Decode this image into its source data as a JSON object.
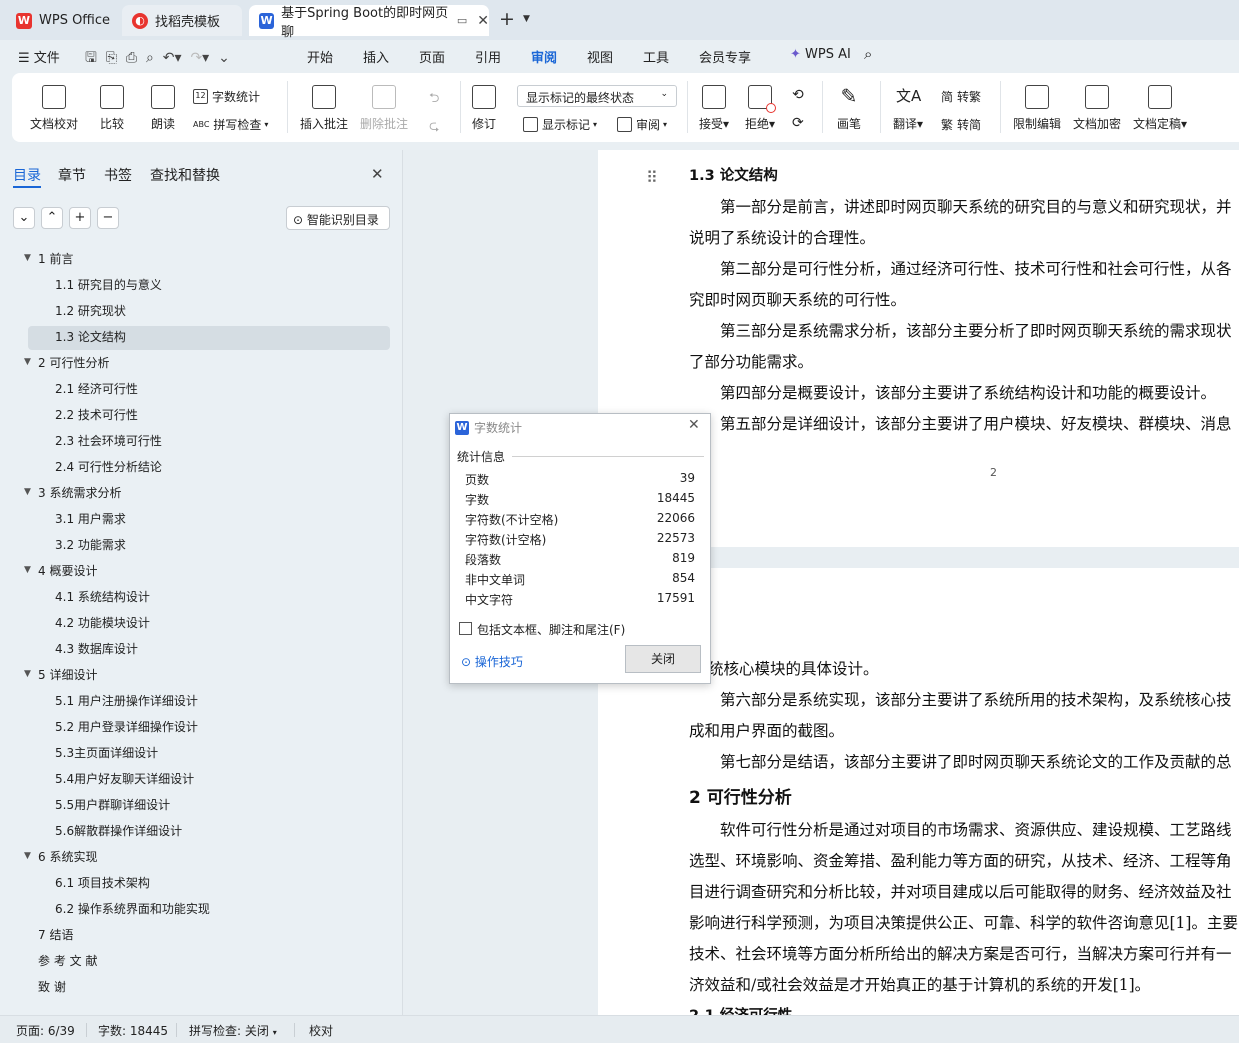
{
  "tabs": {
    "wps": "WPS Office",
    "template": "找稻壳模板",
    "doc": "基于Spring Boot的即时网页聊",
    "add": "+"
  },
  "menu": {
    "file": "文件",
    "items": [
      "开始",
      "插入",
      "页面",
      "引用",
      "审阅",
      "视图",
      "工具",
      "会员专享"
    ],
    "ai": "WPS AI",
    "active": "审阅"
  },
  "ribbon": {
    "proof": "文档校对",
    "compare": "比较",
    "read": "朗读",
    "word_count": "字数统计",
    "spell": "拼写检查",
    "insert_comment": "插入批注",
    "delete_comment": "删除批注",
    "track": "修订",
    "markup_state": "显示标记的最终状态",
    "show_markup": "显示标记",
    "review": "审阅",
    "accept": "接受",
    "reject": "拒绝",
    "pen": "画笔",
    "translate": "翻译",
    "trad": "转繁",
    "simp": "转简",
    "restrict": "限制编辑",
    "encrypt": "文档加密",
    "finalize": "文档定稿"
  },
  "nav": {
    "tabs": [
      "目录",
      "章节",
      "书签",
      "查找和替换"
    ],
    "smart": "智能识别目录",
    "toc": [
      {
        "t": "1   前言",
        "lvl": 1
      },
      {
        "t": "1.1   研究目的与意义",
        "lvl": 2
      },
      {
        "t": "1.2   研究现状",
        "lvl": 2
      },
      {
        "t": "1.3   论文结构",
        "lvl": 2,
        "sel": true
      },
      {
        "t": "2   可行性分析",
        "lvl": 1
      },
      {
        "t": "2.1   经济可行性",
        "lvl": 2
      },
      {
        "t": "2.2   技术可行性",
        "lvl": 2
      },
      {
        "t": "2.3   社会环境可行性",
        "lvl": 2
      },
      {
        "t": "2.4   可行性分析结论",
        "lvl": 2
      },
      {
        "t": "3   系统需求分析",
        "lvl": 1
      },
      {
        "t": "3.1   用户需求",
        "lvl": 2
      },
      {
        "t": "3.2   功能需求",
        "lvl": 2
      },
      {
        "t": "4   概要设计",
        "lvl": 1
      },
      {
        "t": "4.1   系统结构设计",
        "lvl": 2
      },
      {
        "t": "4.2   功能模块设计",
        "lvl": 2
      },
      {
        "t": "4.3   数据库设计",
        "lvl": 2
      },
      {
        "t": "5   详细设计",
        "lvl": 1
      },
      {
        "t": "5.1   用户注册操作详细设计",
        "lvl": 2
      },
      {
        "t": "5.2  用户登录详细操作设计",
        "lvl": 2
      },
      {
        "t": "5.3主页面详细设计",
        "lvl": 2
      },
      {
        "t": "5.4用户好友聊天详细设计",
        "lvl": 2
      },
      {
        "t": "5.5用户群聊详细设计",
        "lvl": 2
      },
      {
        "t": "5.6解散群操作详细设计",
        "lvl": 2
      },
      {
        "t": "6   系统实现",
        "lvl": 1
      },
      {
        "t": "6.1   项目技术架构",
        "lvl": 2
      },
      {
        "t": "6.2   操作系统界面和功能实现",
        "lvl": 2
      },
      {
        "t": "7   结语",
        "lvl": 0
      },
      {
        "t": "参  考  文  献",
        "lvl": 0
      },
      {
        "t": "致          谢",
        "lvl": 0
      }
    ]
  },
  "doc": {
    "p1": [
      "1.3     论文结构",
      "第一部分是前言，讲述即时网页聊天系统的研究目的与意义和研究现状，并",
      "说明了系统设计的合理性。",
      "第二部分是可行性分析，通过经济可行性、技术可行性和社会可行性，从各",
      "究即时网页聊天系统的可行性。",
      "第三部分是系统需求分析，该部分主要分析了即时网页聊天系统的需求现状",
      "了部分功能需求。",
      "第四部分是概要设计，该部分主要讲了系统结构设计和功能的概要设计。",
      "第五部分是详细设计，该部分主要讲了用户模块、好友模块、群模块、消息"
    ],
    "page_num": "2",
    "p2": [
      "统核心模块的具体设计。",
      "第六部分是系统实现，该部分主要讲了系统所用的技术架构，及系统核心技",
      "成和用户界面的截图。",
      "第七部分是结语，该部分主要讲了即时网页聊天系统论文的工作及贡献的总",
      "2     可行性分析",
      "软件可行性分析是通过对项目的市场需求、资源供应、建设规模、工艺路线",
      "选型、环境影响、资金筹措、盈利能力等方面的研究，从技术、经济、工程等角",
      "目进行调查研究和分析比较，并对项目建成以后可能取得的财务、经济效益及社",
      "影响进行科学预测，为项目决策提供公正、可靠、科学的软件咨询意见[1]。主要",
      "技术、社会环境等方面分析所给出的解决方案是否可行，当解决方案可行并有一",
      "济效益和/或社会效益是才开始真正的基于计算机的系统的开发[1]。",
      "2.1     经济可行性"
    ]
  },
  "dialog": {
    "title": "字数统计",
    "section": "统计信息",
    "rows": [
      {
        "k": "页数",
        "v": "39"
      },
      {
        "k": "字数",
        "v": "18445"
      },
      {
        "k": "字符数(不计空格)",
        "v": "22066"
      },
      {
        "k": "字符数(计空格)",
        "v": "22573"
      },
      {
        "k": "段落数",
        "v": "819"
      },
      {
        "k": "非中文单词",
        "v": "854"
      },
      {
        "k": "中文字符",
        "v": "17591"
      }
    ],
    "checkbox": "包括文本框、脚注和尾注(F)",
    "tips": "操作技巧",
    "close": "关闭"
  },
  "status": {
    "page": "页面: 6/39",
    "words": "字数: 18445",
    "spell": "拼写检查: 关闭",
    "proof": "校对"
  },
  "colors": {
    "accent": "#1a66d6",
    "wps_red": "#e8342f",
    "selected_row": "#d5dde3"
  }
}
